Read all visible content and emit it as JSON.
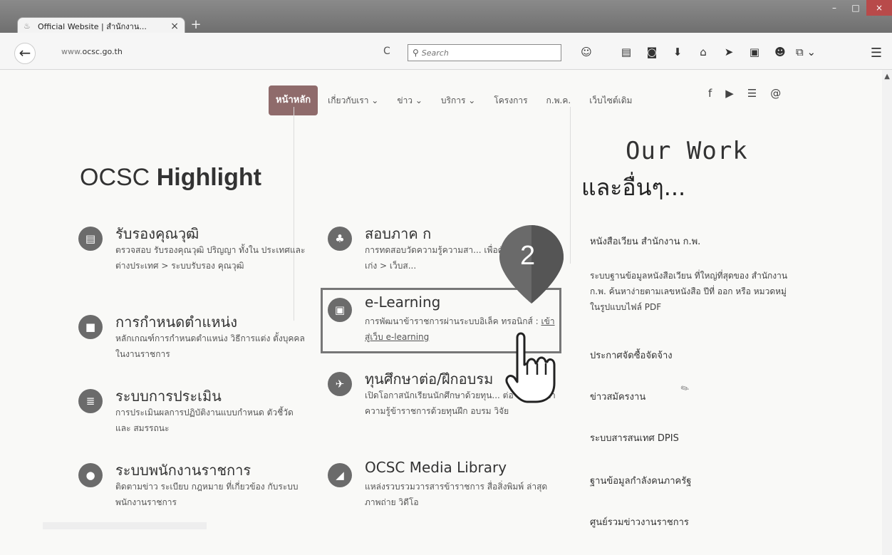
{
  "browser": {
    "tab_title": "Official Website | สำนักงาน...",
    "tab_close": "×",
    "new_tab": "+",
    "url_prefix": "www.",
    "url_domain": "ocsc.go.th",
    "search_placeholder": "Search",
    "window_buttons": [
      "–",
      "□",
      "×"
    ]
  },
  "nav": {
    "home": "หน้าหลัก",
    "items": [
      "เกี่ยวกับเรา ⌄",
      "ข่าว ⌄",
      "บริการ ⌄",
      "โครงการ",
      "ก.พ.ค.",
      "เว็บไซต์เดิม"
    ]
  },
  "social": [
    "f",
    "▶",
    "☰",
    "@"
  ],
  "highlight": {
    "title_light": "OCSC",
    "title_bold": "Highlight"
  },
  "our_work": {
    "title": "Our Work",
    "subtitle": "และอื่นๆ..."
  },
  "cards_left": [
    {
      "title": "รับรองคุณวุฒิ",
      "desc": "ตรวจสอบ รับรองคุณวุฒิ ปริญญา ทั้งใน ประเทศและต่างประเทศ > ระบบรับรอง คุณวุฒิ"
    },
    {
      "title": "การกำหนดตำแหน่ง",
      "desc": "หลักเกณฑ์การกำหนดตำแหน่ง วิธีการแต่ง ตั้งบุคคลในงานราชการ"
    },
    {
      "title": "ระบบการประเมิน",
      "desc": "การประเมินผลการปฏิบัติงานแบบกำหนด ตัวชี้วัด และ สมรรถนะ"
    },
    {
      "title": "ระบบพนักงานราชการ",
      "desc": "ติดตามข่าว ระเบียบ กฎหมาย ที่เกี่ยวข้อง กับระบบพนักงานราชการ"
    }
  ],
  "cards_mid": [
    {
      "title": "สอบภาค ก",
      "desc": "การทดสอบวัดความรู้ความสา... เพื่อคัดสรรคนดีคนเก่ง > เว็บส..."
    },
    {
      "title": "e-Learning",
      "desc": "การพัฒนาข้าราชการผ่านระบบอิเล็ค ทรอนิกส์ :",
      "link": "เข้าสู่เว็บ e-learning"
    },
    {
      "title": "ทุนศึกษาต่อ/ฝึกอบรม",
      "desc": "เปิดโอกาสนักเรียนนักศึกษาด้วยทุน... ต่อ และพัฒนาความรู้ข้าราชการด้วยทุนฝึก อบรม วิจัย"
    },
    {
      "title": "OCSC Media Library",
      "desc": "แหล่งรวบรวมวารสารข้าราชการ สื่อสิ่งพิมพ์ ล่าสุด ภาพถ่าย วิดีโอ"
    }
  ],
  "badge_number": "2",
  "right_list": {
    "circular_title": "หนังสือเวียน สำนักงาน ก.พ.",
    "circular_desc": "ระบบฐานข้อมูลหนังสือเวียน ที่ใหญ่ที่สุดของ สำนักงาน ก.พ. ค้นหาง่ายตามเลขหนังสือ ปีที่ ออก หรือ หมวดหมู่ ในรูปแบบไฟล์ PDF",
    "items": [
      "ประกาศจัดซื้อจัดจ้าง",
      "ข่าวสมัครงาน",
      "ระบบสารสนเทศ DPIS",
      "ฐานข้อมูลกำลังคนภาครัฐ",
      "ศูนย์รวมข่าวงานราชการ"
    ]
  },
  "colors": {
    "home_button": "#8f6b6b",
    "badge": "#6a6a6a",
    "highlight_box": "#777777"
  }
}
